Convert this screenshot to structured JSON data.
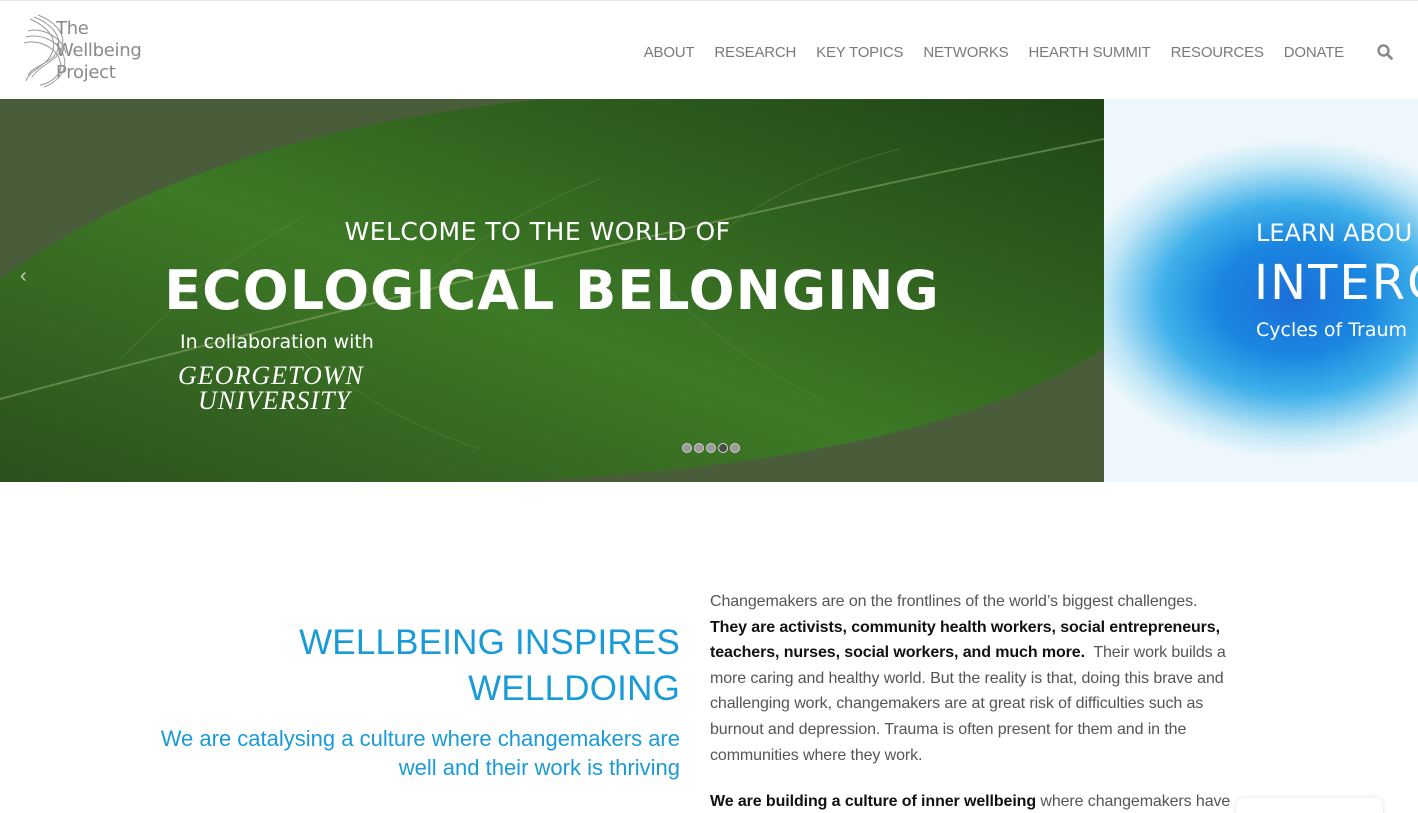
{
  "logo": {
    "line1": "The",
    "line2": "Wellbeing",
    "line3": "Project"
  },
  "nav": [
    "ABOUT",
    "RESEARCH",
    "KEY TOPICS",
    "NETWORKS",
    "HEARTH SUMMIT",
    "RESOURCES",
    "DONATE"
  ],
  "slider": {
    "main": {
      "line1": "WELCOME TO THE WORLD OF",
      "line2": "ECOLOGICAL BELONGING",
      "line3": "In collaboration with",
      "partner_line1": "GEORGETOWN",
      "partner_line2": "UNIVERSITY"
    },
    "next": {
      "line1": "LEARN ABOU",
      "line2": "INTERO",
      "line3": "Cycles of Traum"
    },
    "prev_label": "‹",
    "active_dot": 4,
    "dot_count": 5
  },
  "intro": {
    "headline_line1": "WELLBEING INSPIRES",
    "headline_line2": "WELLDOING",
    "subline": "We are catalysing a culture where changemakers are well and their work is thriving"
  },
  "body": {
    "p1_a": "Changemakers are on the frontlines of the world’s biggest challenges.",
    "p1_bold": "They are activists, community health workers, social entrepreneurs, teachers, nurses, social workers, and much more.",
    "p1_b": "Their work builds a more caring and healthy world.  But the reality is that, doing this brave and challenging work, changemakers are at great risk of difficulties such as burnout and depression.  Trauma is often present for them and in the communities where they work.",
    "p2_bold": "We are building a culture of inner wellbeing",
    "p2_a": "where changemakers have"
  },
  "colors": {
    "accent": "#1a9bd7",
    "nav_text": "#7a7a7a"
  },
  "icons": {
    "search": "search-icon",
    "logo": "logo-mark-icon"
  }
}
